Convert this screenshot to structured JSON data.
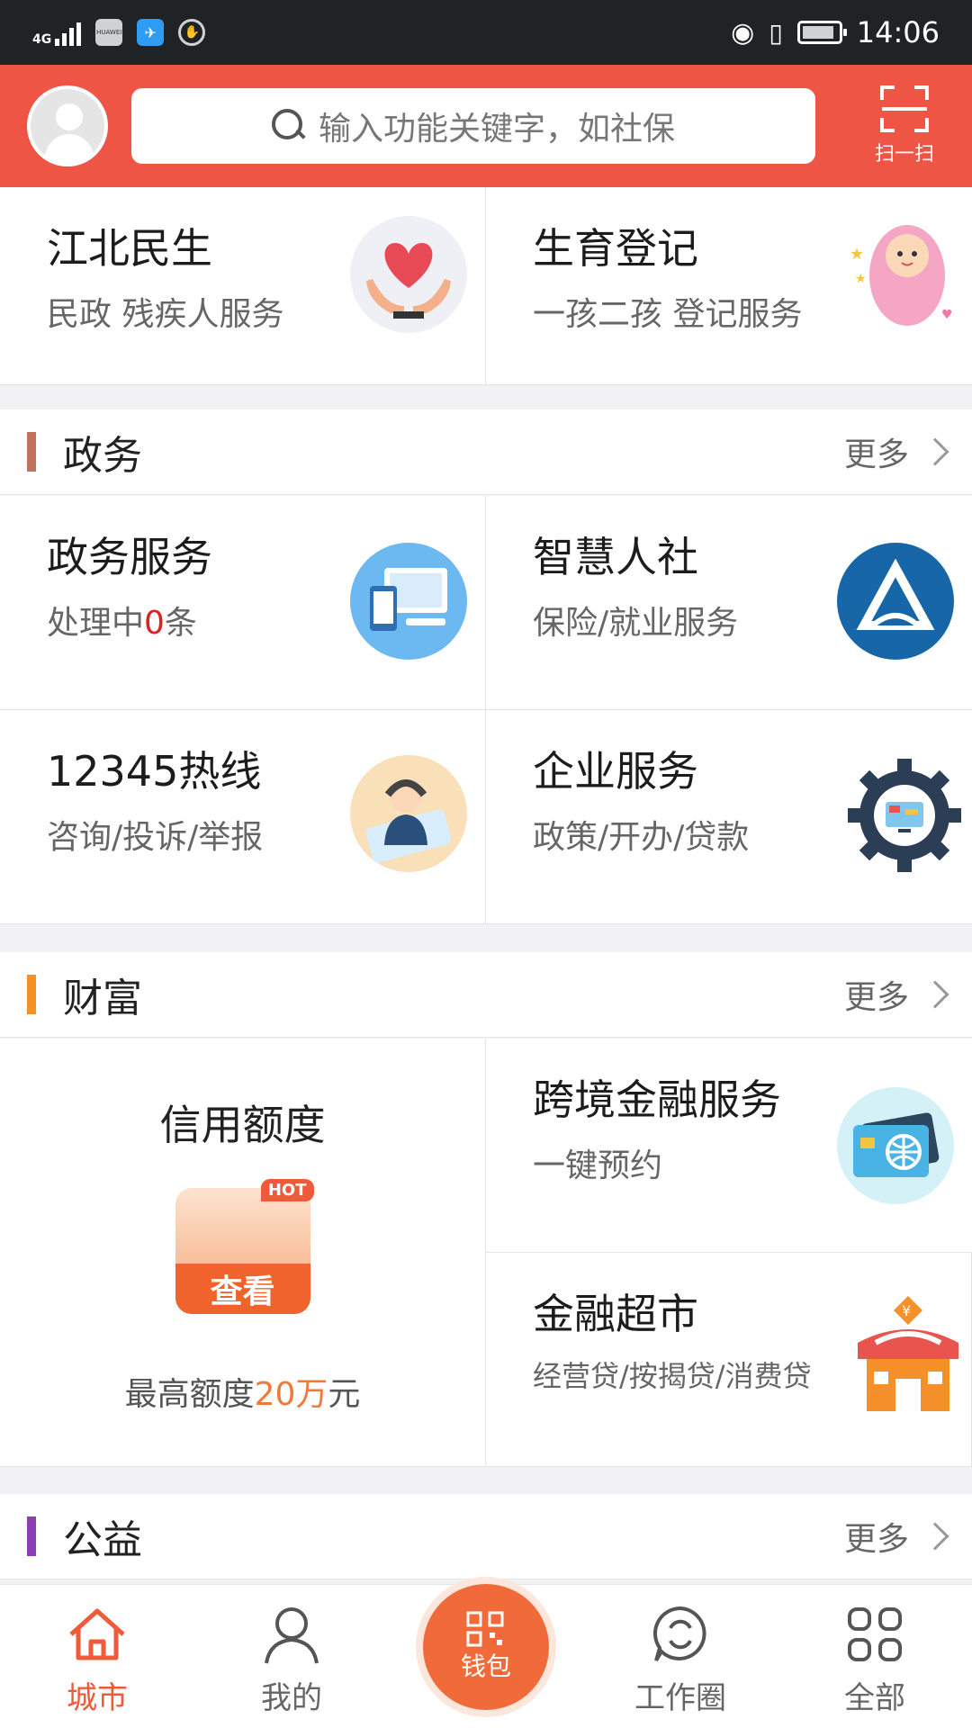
{
  "status_bar": {
    "network": "4G",
    "brand": "HUAWEI",
    "time": "14:06",
    "battery_level": 0.9
  },
  "header": {
    "search_placeholder": "输入功能关键字，如社保",
    "scan_label": "扫一扫"
  },
  "top_cards": [
    {
      "title": "江北民生",
      "subtitle": "民政  残疾人服务",
      "icon": "heart-hands-icon"
    },
    {
      "title": "生育登记",
      "subtitle": "一孩二孩 登记服务",
      "icon": "baby-icon"
    }
  ],
  "sections": {
    "gov": {
      "title": "政务",
      "more": "更多",
      "accent": "#c0735a"
    },
    "wealth": {
      "title": "财富",
      "more": "更多",
      "accent": "#f5902a"
    },
    "charity": {
      "title": "公益",
      "more": "更多",
      "accent": "#8b3fb0"
    }
  },
  "gov_cards": [
    {
      "title": "政务服务",
      "subtitle_prefix": "处理中",
      "count": "0",
      "subtitle_suffix": "条",
      "icon": "computer-icon"
    },
    {
      "title": "智慧人社",
      "subtitle": "保险/就业服务",
      "icon": "social-security-logo-icon"
    },
    {
      "title": "12345热线",
      "subtitle": "咨询/投诉/举报",
      "icon": "hotline-agent-icon"
    },
    {
      "title": "企业服务",
      "subtitle": "政策/开办/贷款",
      "icon": "gear-icon"
    }
  ],
  "wealth": {
    "credit": {
      "title": "信用额度",
      "hot": "HOT",
      "button": "查看",
      "limit_prefix": "最高额度",
      "limit_value": "20万",
      "limit_suffix": "元"
    },
    "cards": [
      {
        "title": "跨境金融服务",
        "subtitle": "一键预约",
        "icon": "card-globe-icon"
      },
      {
        "title": "金融超市",
        "subtitle": "经营贷/按揭贷/消费贷",
        "icon": "shop-icon"
      }
    ]
  },
  "nav": [
    {
      "label": "城市",
      "icon": "home-icon",
      "active": true
    },
    {
      "label": "我的",
      "icon": "user-icon"
    },
    {
      "label": "钱包",
      "icon": "qr-wallet-icon"
    },
    {
      "label": "工作圈",
      "icon": "chat-icon"
    },
    {
      "label": "全部",
      "icon": "grid-icon"
    }
  ]
}
